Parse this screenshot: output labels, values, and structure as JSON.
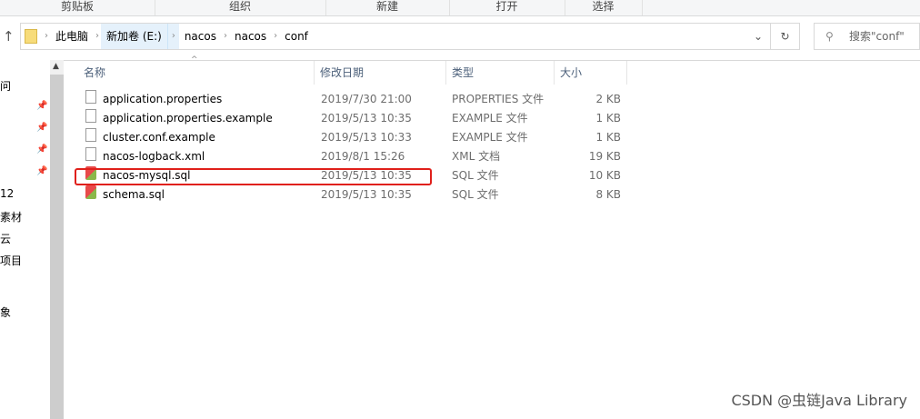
{
  "ribbon": {
    "groups": [
      "剪贴板",
      "组织",
      "新建",
      "打开",
      "选择"
    ]
  },
  "address": {
    "crumbs": [
      "此电脑",
      "新加卷 (E:)",
      "nacos",
      "nacos",
      "conf"
    ]
  },
  "search": {
    "placeholder": "搜索\"conf\""
  },
  "columns": [
    "名称",
    "修改日期",
    "类型",
    "大小"
  ],
  "files": [
    {
      "name": "application.properties",
      "date": "2019/7/30 21:00",
      "type": "PROPERTIES 文件",
      "size": "2 KB",
      "icon": "file-icon"
    },
    {
      "name": "application.properties.example",
      "date": "2019/5/13 10:35",
      "type": "EXAMPLE 文件",
      "size": "1 KB",
      "icon": "file-icon"
    },
    {
      "name": "cluster.conf.example",
      "date": "2019/5/13 10:33",
      "type": "EXAMPLE 文件",
      "size": "1 KB",
      "icon": "file-icon"
    },
    {
      "name": "nacos-logback.xml",
      "date": "2019/8/1 15:26",
      "type": "XML 文档",
      "size": "19 KB",
      "icon": "file-icon"
    },
    {
      "name": "nacos-mysql.sql",
      "date": "2019/5/13 10:35",
      "type": "SQL 文件",
      "size": "10 KB",
      "icon": "sql-file-icon"
    },
    {
      "name": "schema.sql",
      "date": "2019/5/13 10:35",
      "type": "SQL 文件",
      "size": "8 KB",
      "icon": "sql-file-icon"
    }
  ],
  "sidebar": [
    "问",
    "12",
    "素材",
    "云",
    "项目",
    "象"
  ],
  "highlight_color": "#e0201b",
  "watermark": "CSDN @虫链Java Library"
}
